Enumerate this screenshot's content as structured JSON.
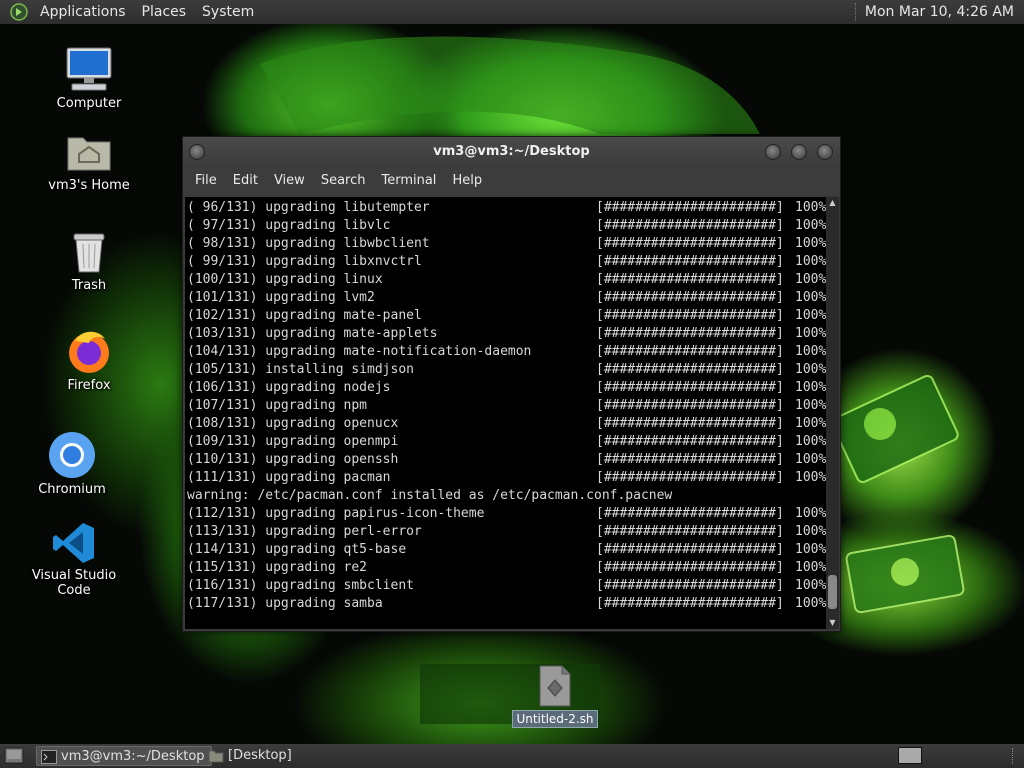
{
  "top_panel": {
    "menus": [
      "Applications",
      "Places",
      "System"
    ],
    "clock": "Mon Mar 10,  4:26 AM"
  },
  "desktop_icons": [
    {
      "label": "Computer",
      "icon": "computer-icon"
    },
    {
      "label": "vm3's Home",
      "icon": "home-folder-icon"
    },
    {
      "label": "Trash",
      "icon": "trash-icon"
    },
    {
      "label": "Firefox",
      "icon": "firefox-icon"
    },
    {
      "label": "Chromium",
      "icon": "chromium-icon"
    },
    {
      "label": "Visual Studio Code",
      "icon": "vscode-icon"
    }
  ],
  "terminal": {
    "title": "vm3@vm3:~/Desktop",
    "menu": [
      "File",
      "Edit",
      "View",
      "Search",
      "Terminal",
      "Help"
    ],
    "progress_bar": "[######################]",
    "lines": [
      {
        "text": "( 96/131) upgrading libutempter",
        "pct": "100%"
      },
      {
        "text": "( 97/131) upgrading libvlc",
        "pct": "100%"
      },
      {
        "text": "( 98/131) upgrading libwbclient",
        "pct": "100%"
      },
      {
        "text": "( 99/131) upgrading libxnvctrl",
        "pct": "100%"
      },
      {
        "text": "(100/131) upgrading linux",
        "pct": "100%"
      },
      {
        "text": "(101/131) upgrading lvm2",
        "pct": "100%"
      },
      {
        "text": "(102/131) upgrading mate-panel",
        "pct": "100%"
      },
      {
        "text": "(103/131) upgrading mate-applets",
        "pct": "100%"
      },
      {
        "text": "(104/131) upgrading mate-notification-daemon",
        "pct": "100%"
      },
      {
        "text": "(105/131) installing simdjson",
        "pct": "100%"
      },
      {
        "text": "(106/131) upgrading nodejs",
        "pct": "100%"
      },
      {
        "text": "(107/131) upgrading npm",
        "pct": "100%"
      },
      {
        "text": "(108/131) upgrading openucx",
        "pct": "100%"
      },
      {
        "text": "(109/131) upgrading openmpi",
        "pct": "100%"
      },
      {
        "text": "(110/131) upgrading openssh",
        "pct": "100%"
      },
      {
        "text": "(111/131) upgrading pacman",
        "pct": "100%"
      },
      {
        "text": "warning: /etc/pacman.conf installed as /etc/pacman.conf.pacnew",
        "pct": null
      },
      {
        "text": "(112/131) upgrading papirus-icon-theme",
        "pct": "100%"
      },
      {
        "text": "(113/131) upgrading perl-error",
        "pct": "100%"
      },
      {
        "text": "(114/131) upgrading qt5-base",
        "pct": "100%"
      },
      {
        "text": "(115/131) upgrading re2",
        "pct": "100%"
      },
      {
        "text": "(116/131) upgrading smbclient",
        "pct": "100%"
      },
      {
        "text": "(117/131) upgrading samba",
        "pct": "100%"
      }
    ]
  },
  "desktop_file": {
    "label": "Untitled-2.sh",
    "icon": "shell-script-icon"
  },
  "taskbar": {
    "tasks": [
      {
        "label": "vm3@vm3:~/Desktop",
        "icon": "terminal-icon",
        "active": true
      },
      {
        "label": "[Desktop]",
        "icon": "folder-icon",
        "active": false
      }
    ]
  },
  "colors": {
    "panel": "#2e2e2e",
    "terminal_bg": "#000000",
    "terminal_fg": "#d8d8d8",
    "wallpaper_accent": "#4ab820"
  }
}
